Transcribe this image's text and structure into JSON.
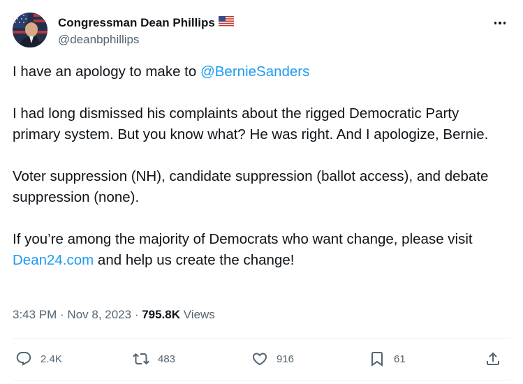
{
  "author": {
    "display_name": "Congressman Dean Phillips",
    "flag": "🇺🇸",
    "handle": "@deanbphillips"
  },
  "tweet": {
    "line1_prefix": "I have an apology to make to ",
    "line1_mention": "@BernieSanders",
    "para2": "I had long dismissed his complaints about the rigged Democratic Party primary system. But you know what? He was right. And I apologize, Bernie.",
    "para3": "Voter suppression (NH), candidate suppression (ballot access), and debate suppression (none).",
    "para4_text": "If you’re among the majority of Democrats who want change, please visit ",
    "para4_link": "Dean24.com",
    "para4_suffix": " and help us create the change!"
  },
  "meta": {
    "time": "3:43 PM",
    "sep1": " · ",
    "date": "Nov 8, 2023",
    "sep2": " · ",
    "views_count": "795.8K",
    "views_label": " Views"
  },
  "actions": {
    "replies": "2.4K",
    "reposts": "483",
    "likes": "916",
    "bookmarks": "61"
  },
  "icons": {
    "more": "more-options-icon",
    "reply": "reply-icon",
    "repost": "repost-icon",
    "like": "heart-icon",
    "bookmark": "bookmark-icon",
    "share": "share-icon"
  },
  "colors": {
    "link": "#1d9bf0",
    "secondary_text": "#536471",
    "primary_text": "#0f1419"
  }
}
